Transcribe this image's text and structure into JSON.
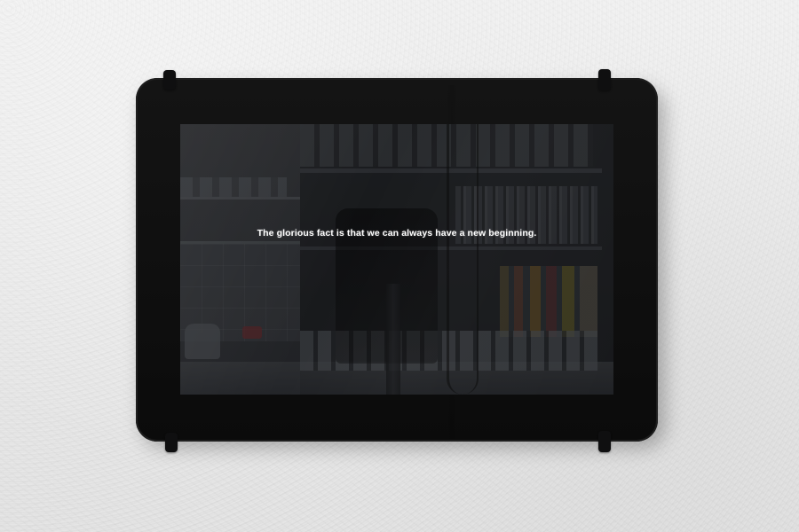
{
  "screen": {
    "quote_text": "The glorious fact is that we can always have a new beginning."
  },
  "icons": {
    "top_left_clip": "wall-mount-clip-icon",
    "top_right_clip": "wall-mount-clip-icon",
    "bottom_left_clip": "wall-mount-clip-icon",
    "bottom_right_clip": "wall-mount-clip-icon"
  },
  "colors": {
    "wall": "#ececec",
    "tablet_frame": "#111111",
    "text": "#ffffff"
  }
}
